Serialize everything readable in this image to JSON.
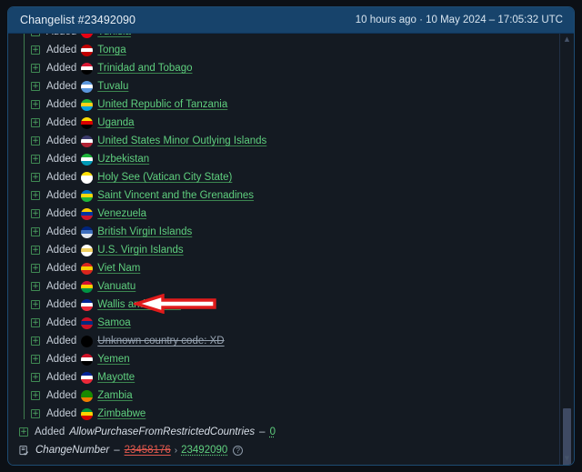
{
  "header": {
    "title": "Changelist #23492090",
    "meta": "10 hours ago · 10 May 2024 – 17:05:32 UTC"
  },
  "colors": {
    "panel_bg": "#141a22",
    "header_bg": "#17436b",
    "added_green": "#5fcf7e",
    "removed_red": "#e2584d",
    "guide_green": "#3f7d4e",
    "annotation_red": "#e01b1b",
    "scroll_thumb": "#3e4a63"
  },
  "list": {
    "verb": "Added",
    "expander": "+",
    "rows": [
      {
        "verb": "Added",
        "name": "Tunisia",
        "flag": [
          "#e70013",
          "#ffffff",
          "#e70013"
        ],
        "removed": false
      },
      {
        "verb": "Added",
        "name": "Tonga",
        "flag": [
          "#c10000",
          "#ffffff",
          "#c10000"
        ],
        "removed": false
      },
      {
        "verb": "Added",
        "name": "Trinidad and Tobago",
        "flag": [
          "#da1a35",
          "#ffffff",
          "#000000"
        ],
        "removed": false
      },
      {
        "verb": "Added",
        "name": "Tuvalu",
        "flag": [
          "#5b97dd",
          "#ffffff",
          "#5b97dd"
        ],
        "removed": false
      },
      {
        "verb": "Added",
        "name": "United Republic of Tanzania",
        "flag": [
          "#1eb53a",
          "#fcd116",
          "#00a3dd"
        ],
        "removed": false
      },
      {
        "verb": "Added",
        "name": "Uganda",
        "flag": [
          "#fcdc04",
          "#d90000",
          "#000000"
        ],
        "removed": false
      },
      {
        "verb": "Added",
        "name": "United States Minor Outlying Islands",
        "flag": [
          "#3c3b6e",
          "#ffffff",
          "#b22234"
        ],
        "removed": false
      },
      {
        "verb": "Added",
        "name": "Uzbekistan",
        "flag": [
          "#1eb53a",
          "#ffffff",
          "#0099b5"
        ],
        "removed": false
      },
      {
        "verb": "Added",
        "name": "Holy See (Vatican City State)",
        "flag": [
          "#ffe000",
          "#ffffff",
          "#ffffff"
        ],
        "removed": false
      },
      {
        "verb": "Added",
        "name": "Saint Vincent and the Grenadines",
        "flag": [
          "#0072c6",
          "#f8d80e",
          "#1eb53a"
        ],
        "removed": false
      },
      {
        "verb": "Added",
        "name": "Venezuela",
        "flag": [
          "#ffcc00",
          "#0033a0",
          "#cf142b"
        ],
        "removed": false
      },
      {
        "verb": "Added",
        "name": "British Virgin Islands",
        "flag": [
          "#00247d",
          "#3f6fbe",
          "#e2e8f0"
        ],
        "removed": false
      },
      {
        "verb": "Added",
        "name": "U.S. Virgin Islands",
        "flag": [
          "#ffffff",
          "#f0d060",
          "#ffffff"
        ],
        "removed": false
      },
      {
        "verb": "Added",
        "name": "Viet Nam",
        "flag": [
          "#da251d",
          "#f6d000",
          "#da251d"
        ],
        "removed": false
      },
      {
        "verb": "Added",
        "name": "Vanuatu",
        "flag": [
          "#d21034",
          "#ffce00",
          "#009543"
        ],
        "removed": false
      },
      {
        "verb": "Added",
        "name": "Wallis and Futuna",
        "flag": [
          "#002395",
          "#ffffff",
          "#ed2939"
        ],
        "removed": false
      },
      {
        "verb": "Added",
        "name": "Samoa",
        "flag": [
          "#ce1126",
          "#002b7f",
          "#ce1126"
        ],
        "removed": false
      },
      {
        "verb": "Added",
        "name": "Unknown country code: XD",
        "flag": [
          "#000000",
          "#000000",
          "#000000"
        ],
        "removed": true
      },
      {
        "verb": "Added",
        "name": "Yemen",
        "flag": [
          "#ce1126",
          "#ffffff",
          "#000000"
        ],
        "removed": false
      },
      {
        "verb": "Added",
        "name": "Mayotte",
        "flag": [
          "#002395",
          "#ffffff",
          "#ed2939"
        ],
        "removed": false
      },
      {
        "verb": "Added",
        "name": "Zambia",
        "flag": [
          "#198a00",
          "#198a00",
          "#ef7d00"
        ],
        "removed": false
      },
      {
        "verb": "Added",
        "name": "Zimbabwe",
        "flag": [
          "#009639",
          "#ffd200",
          "#d40000"
        ],
        "removed": false
      }
    ]
  },
  "footer": {
    "allow_row": {
      "expander": "+",
      "verb": "Added",
      "key": "AllowPurchaseFromRestrictedCountries",
      "dash": "–",
      "value": "0"
    },
    "change_row": {
      "key": "ChangeNumber",
      "dash": "–",
      "old_value": "23458176",
      "separator": "›",
      "new_value": "23492090",
      "help": "?"
    }
  },
  "scrollbar": {
    "up": "▲",
    "down": "▼"
  },
  "annotation": {
    "type": "arrow",
    "direction": "left",
    "points_at": "Viet Nam"
  }
}
